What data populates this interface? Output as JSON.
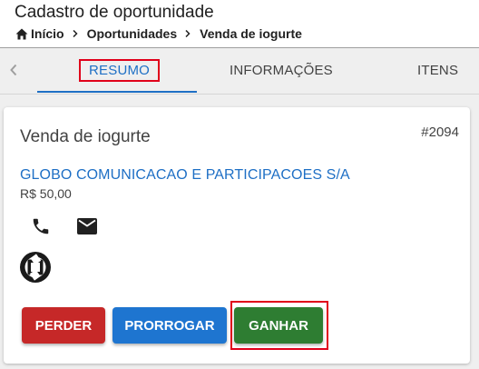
{
  "header": {
    "title": "Cadastro de oportunidade",
    "breadcrumb": [
      "Início",
      "Oportunidades",
      "Venda de iogurte"
    ]
  },
  "tabs": [
    {
      "label": "RESUMO",
      "active": true
    },
    {
      "label": "INFORMAÇÕES",
      "active": false
    },
    {
      "label": "ITENS",
      "active": false
    }
  ],
  "card": {
    "title": "Venda de iogurte",
    "id": "#2094",
    "company": "GLOBO COMUNICACAO E PARTICIPACOES S/A",
    "value": "R$ 50,00"
  },
  "actions": {
    "lose": "PERDER",
    "extend": "PRORROGAR",
    "win": "GANHAR"
  },
  "icons": [
    "home-icon",
    "chevron-right-icon",
    "chevron-left-icon",
    "phone-icon",
    "mail-icon",
    "totvs-logo-icon"
  ],
  "colors": {
    "accent": "#1e6fc5",
    "lose": "#c62828",
    "extend": "#1e75d0",
    "win": "#2e7d32",
    "highlight": "#e0001a"
  }
}
